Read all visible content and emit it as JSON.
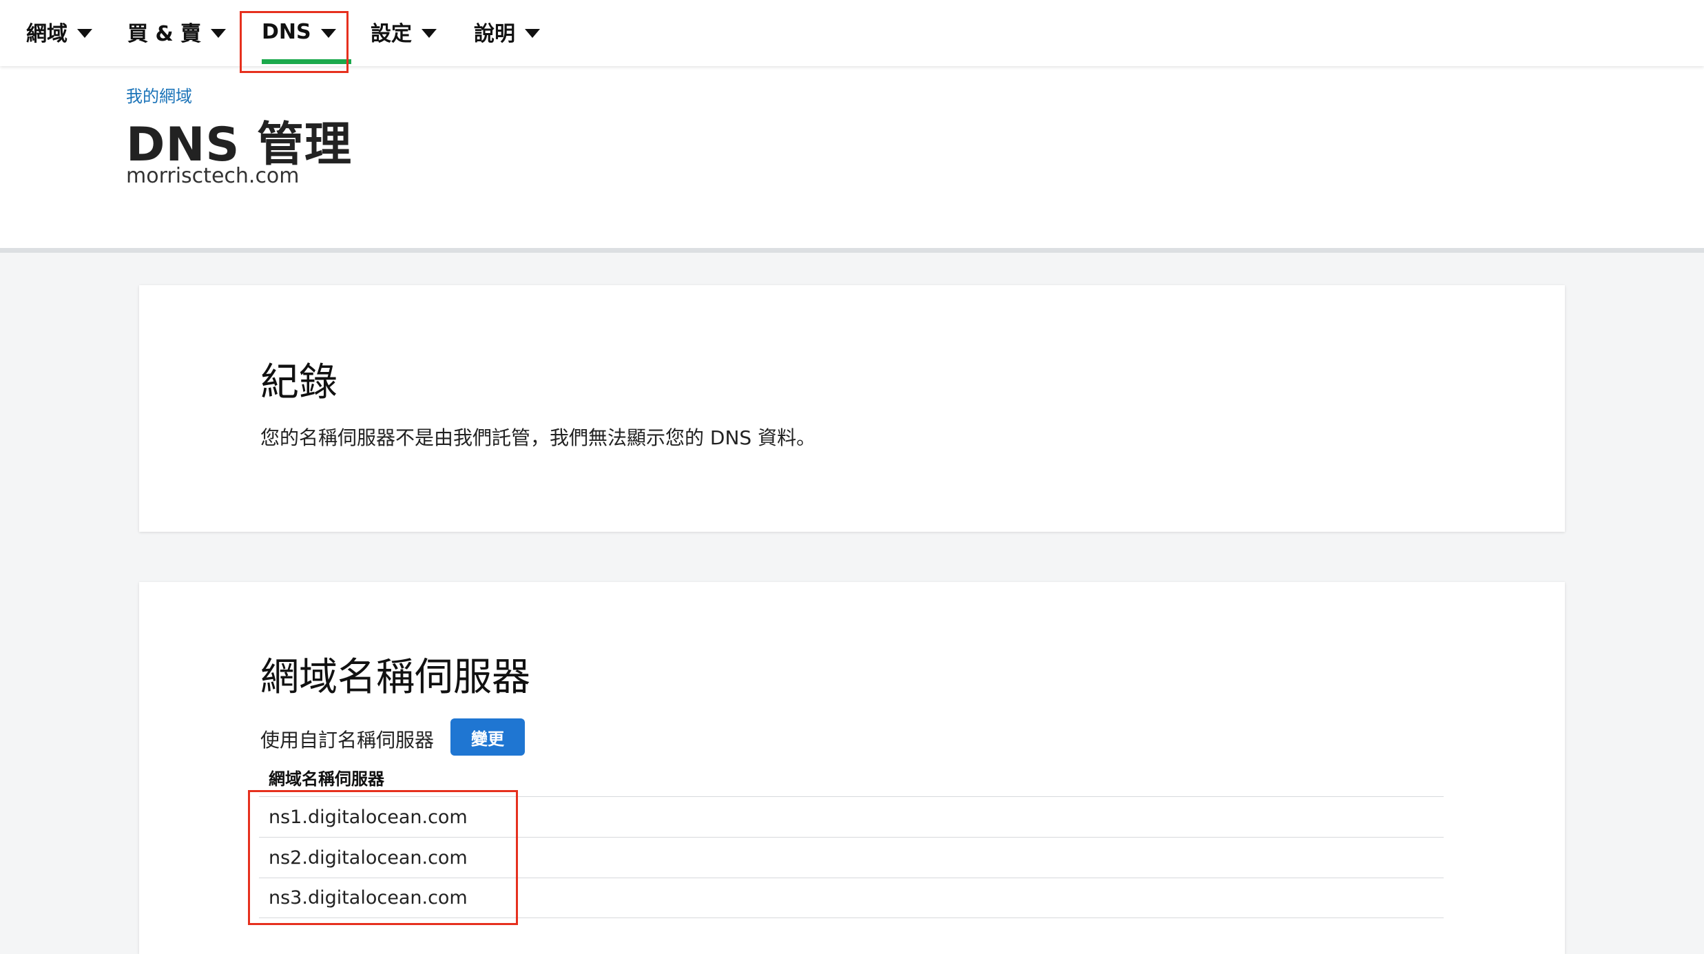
{
  "nav": {
    "items": [
      {
        "label": "網域"
      },
      {
        "label": "買 & 賣"
      },
      {
        "label": "DNS"
      },
      {
        "label": "設定"
      },
      {
        "label": "說明"
      }
    ],
    "active_index": 2,
    "active_color": "#1ba94c"
  },
  "header": {
    "breadcrumb": "我的網域",
    "title": "DNS 管理",
    "domain": "morrisctech.com"
  },
  "records": {
    "title": "紀錄",
    "message": "您的名稱伺服器不是由我們託管，我們無法顯示您的 DNS 資料。"
  },
  "nameservers": {
    "title": "網域名稱伺服器",
    "mode_label": "使用自訂名稱伺服器",
    "change_label": "變更",
    "column_header": "網域名稱伺服器",
    "rows": [
      "ns1.digitalocean.com",
      "ns2.digitalocean.com",
      "ns3.digitalocean.com"
    ]
  },
  "colors": {
    "accent_button": "#1f76d2",
    "highlight_box": "#e6301e",
    "link": "#1a73b8"
  }
}
